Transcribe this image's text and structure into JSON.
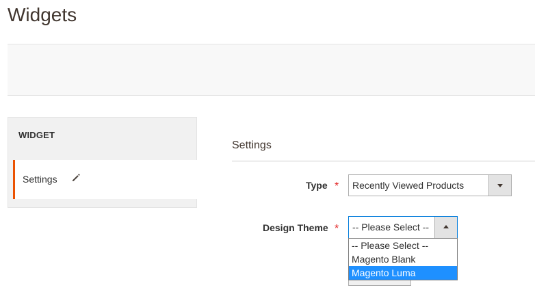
{
  "page": {
    "title": "Widgets"
  },
  "sidebar": {
    "title": "WIDGET",
    "items": [
      {
        "label": "Settings",
        "icon": "pencil-icon"
      }
    ],
    "accent_color": "#eb5202"
  },
  "form": {
    "section_title": "Settings",
    "required_symbol": "*",
    "fields": {
      "type": {
        "label": "Type",
        "value": "Recently Viewed Products"
      },
      "design_theme": {
        "label": "Design Theme",
        "value": "-- Please Select --",
        "options": [
          "-- Please Select --",
          "Magento Blank",
          "Magento Luma"
        ],
        "highlighted_option": "Magento Luma"
      }
    }
  },
  "colors": {
    "required": "#e22626",
    "highlight": "#1e90ff",
    "focus_border": "#007bdb"
  }
}
